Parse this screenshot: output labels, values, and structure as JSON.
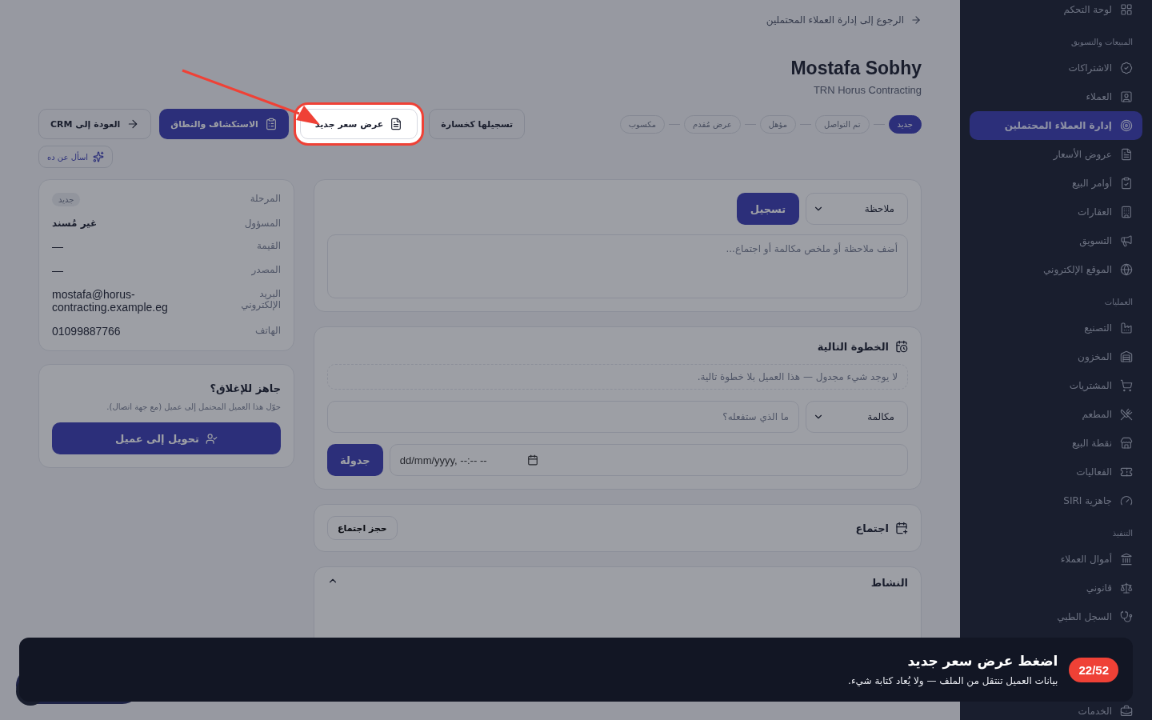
{
  "back_link": "الرجوع إلى إدارة العملاء المحتملين",
  "lead": {
    "name": "Mostafa Sobhy",
    "company": "TRN Horus Contracting"
  },
  "stages": [
    {
      "label": "جديد",
      "selected": true
    },
    {
      "label": "تم التواصل",
      "selected": false
    },
    {
      "label": "مؤهل",
      "selected": false
    },
    {
      "label": "عرض مُقدم",
      "selected": false
    },
    {
      "label": "مكسوب",
      "selected": false
    }
  ],
  "actions": [
    {
      "label": "تسجيلها كخسارة",
      "kind": "lost"
    },
    {
      "label": "عرض سعر جديد",
      "kind": "quote",
      "highlighted": true
    },
    {
      "label": "الاستكشاف والنطاق",
      "kind": "discovery"
    },
    {
      "label": "العودة إلى CRM",
      "kind": "back"
    }
  ],
  "ask_button": "اسأل عن ده",
  "note": {
    "type": "ملاحظة",
    "submit": "تسجيل",
    "placeholder": "أضف ملاحظة أو ملخص مكالمة أو اجتماع..."
  },
  "next_step": {
    "title": "الخطوة التالية",
    "empty": "لا يوجد شيء مجدول — هذا العميل بلا خطوة تالية.",
    "type": "مكالمة",
    "placeholder": "ما الذي ستفعله؟",
    "datetime_placeholder": "dd/mm/yyyy, --:-- --",
    "submit": "جدولة"
  },
  "meeting": {
    "title": "اجتماع",
    "button": "حجز اجتماع"
  },
  "activity": {
    "title": "النشاط",
    "expanded": true
  },
  "details": [
    {
      "label": "المرحلة",
      "value": "جديد",
      "kind": "badge"
    },
    {
      "label": "المسؤول",
      "value": "غير مُسند",
      "kind": "strong"
    },
    {
      "label": "القيمة",
      "value": "—",
      "kind": "text"
    },
    {
      "label": "المصدر",
      "value": "—",
      "kind": "text"
    },
    {
      "label": "البريد الإلكتروني",
      "value": "mostafa@horus-contracting.example.eg",
      "kind": "text"
    },
    {
      "label": "الهاتف",
      "value": "01099887766",
      "kind": "text"
    }
  ],
  "convert": {
    "title": "جاهز للإغلاق؟",
    "text": "حوّل هذا العميل المحتمل إلى عميل (مع جهة اتصال).",
    "button": "تحويل إلى عميل"
  },
  "sidebar": [
    {
      "items": [
        {
          "label": "لوحة التحكم",
          "selected": false
        }
      ]
    },
    {
      "title": "المبيعات والتسويق",
      "items": [
        {
          "label": "الاشتراكات",
          "selected": false
        },
        {
          "label": "العملاء",
          "selected": false
        },
        {
          "label": "إدارة العملاء المحتملين",
          "selected": true
        },
        {
          "label": "عروض الأسعار",
          "selected": false
        },
        {
          "label": "أوامر البيع",
          "selected": false
        },
        {
          "label": "العقارات",
          "selected": false
        },
        {
          "label": "التسويق",
          "selected": false
        },
        {
          "label": "الموقع الإلكتروني",
          "selected": false
        }
      ]
    },
    {
      "title": "العمليات",
      "items": [
        {
          "label": "التصنيع",
          "selected": false
        },
        {
          "label": "المخزون",
          "selected": false
        },
        {
          "label": "المشتريات",
          "selected": false
        },
        {
          "label": "المطعم",
          "selected": false
        },
        {
          "label": "نقطة البيع",
          "selected": false
        },
        {
          "label": "الفعاليات",
          "selected": false
        },
        {
          "label": "جاهزية SIRI",
          "selected": false
        }
      ]
    },
    {
      "title": "التنفيذ",
      "items": [
        {
          "label": "أموال العملاء",
          "selected": false
        },
        {
          "label": "قانوني",
          "selected": false
        },
        {
          "label": "السجل الطبي",
          "selected": false
        },
        {
          "label": "الخدمات",
          "selected": false
        }
      ]
    }
  ],
  "tour": {
    "step": "22/52",
    "title": "اضغط عرض سعر جديد",
    "text": "بيانات العميل تنتقل من الملف — ولا يُعاد كتابة شيء."
  }
}
